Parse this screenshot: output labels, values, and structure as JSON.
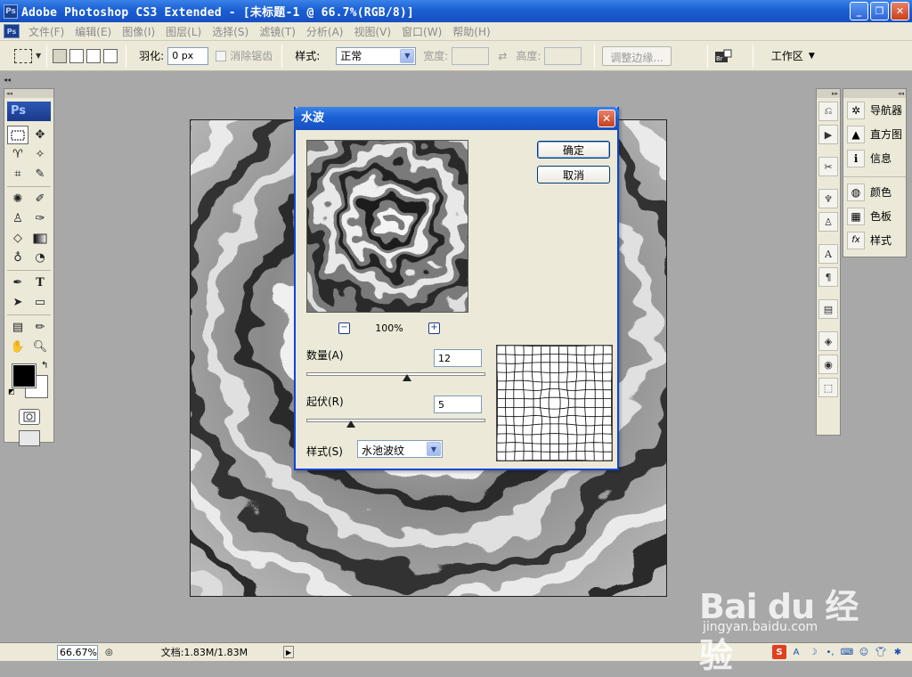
{
  "window": {
    "app_badge": "Ps",
    "title": "Adobe Photoshop CS3 Extended - [未标题-1 @ 66.7%(RGB/8)]",
    "controls": {
      "minimize": "_",
      "restore": "❐",
      "close": "✕"
    }
  },
  "menubar": {
    "items": [
      "文件(F)",
      "编辑(E)",
      "图像(I)",
      "图层(L)",
      "选择(S)",
      "滤镜(T)",
      "分析(A)",
      "视图(V)",
      "窗口(W)",
      "帮助(H)"
    ]
  },
  "options": {
    "feather_label": "羽化:",
    "feather_value": "0 px",
    "antialias_label": "消除锯齿",
    "style_label": "样式:",
    "style_value": "正常",
    "width_label": "宽度:",
    "height_label": "高度:",
    "refine_label": "调整边缘...",
    "workspace_label": "工作区"
  },
  "toolbox": {
    "logo": "Ps"
  },
  "panels": {
    "items": [
      {
        "label": "导航器",
        "icon": "navigator-icon",
        "glyph": "✲"
      },
      {
        "label": "直方图",
        "icon": "histogram-icon",
        "glyph": "▲"
      },
      {
        "label": "信息",
        "icon": "info-icon",
        "glyph": "ℹ"
      },
      {
        "label": "颜色",
        "icon": "color-icon",
        "glyph": "◍"
      },
      {
        "label": "色板",
        "icon": "swatches-icon",
        "glyph": "▦"
      },
      {
        "label": "样式",
        "icon": "styles-icon",
        "glyph": "fx"
      }
    ]
  },
  "status": {
    "zoom": "66.67%",
    "doc": "文档:1.83M/1.83M"
  },
  "watermark": {
    "brand": "Bai du 经验",
    "url": "jingyan.baidu.com"
  },
  "dialog": {
    "title": "水波",
    "ok_label": "确定",
    "cancel_label": "取消",
    "zoom_out": "−",
    "zoom_in": "+",
    "zoom_percent": "100%",
    "amount_label": "数量(A)",
    "amount_value": "12",
    "amount_slider": 0.56,
    "ridges_label": "起伏(R)",
    "ridges_value": "5",
    "ridges_slider": 0.25,
    "style_label": "样式(S)",
    "style_value": "水池波纹"
  },
  "colors": {
    "titlebar": "#1a5fd4",
    "chrome": "#ece9d8",
    "workspace": "#a8a8a8",
    "close_red": "#c8401c"
  }
}
